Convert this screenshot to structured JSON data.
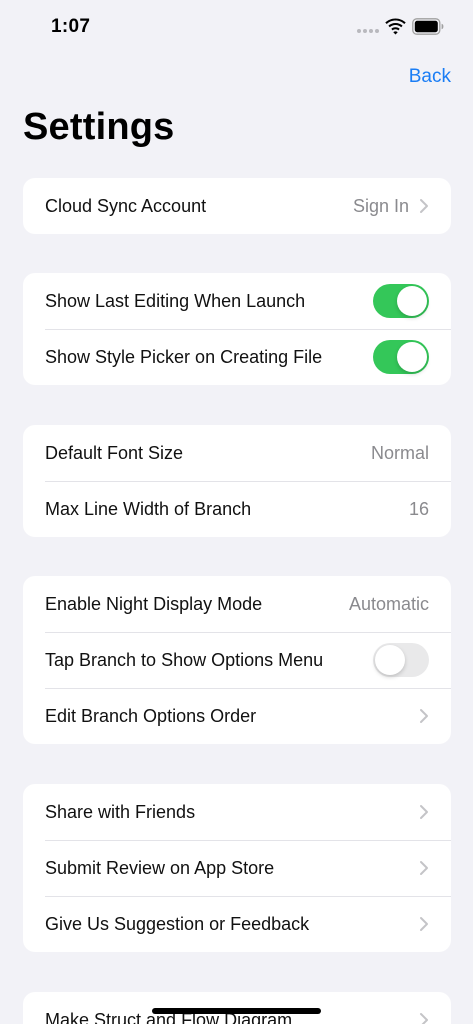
{
  "status_bar": {
    "time": "1:07",
    "icons": [
      "cellular-dots-icon",
      "wifi-icon",
      "battery-icon"
    ]
  },
  "nav": {
    "back_label": "Back",
    "title": "Settings"
  },
  "colors": {
    "accent": "#1a7df5",
    "toggle_on": "#34c759",
    "toggle_off": "#e9e9ea",
    "background": "#f2f2f7",
    "secondary_text": "#8a8a8e"
  },
  "groups": [
    {
      "rows": [
        {
          "label": "Cloud Sync Account",
          "value": "Sign In",
          "accessory": "chevron-right-icon"
        }
      ]
    },
    {
      "rows": [
        {
          "label": "Show Last Editing When Launch",
          "toggle": true
        },
        {
          "label": "Show Style Picker on Creating File",
          "toggle": true
        }
      ]
    },
    {
      "rows": [
        {
          "label": "Default Font Size",
          "value": "Normal"
        },
        {
          "label": "Max Line Width of Branch",
          "value": "16"
        }
      ]
    },
    {
      "rows": [
        {
          "label": "Enable Night Display Mode",
          "value": "Automatic"
        },
        {
          "label": "Tap Branch to Show Options Menu",
          "toggle": false
        },
        {
          "label": "Edit Branch Options Order",
          "accessory": "chevron-right-icon"
        }
      ]
    },
    {
      "rows": [
        {
          "label": "Share with Friends",
          "accessory": "chevron-right-icon"
        },
        {
          "label": "Submit Review on App Store",
          "accessory": "chevron-right-icon"
        },
        {
          "label": "Give Us Suggestion or Feedback",
          "accessory": "chevron-right-icon"
        }
      ]
    },
    {
      "rows": [
        {
          "label": "Make Struct and Flow Diagram",
          "accessory": "chevron-right-icon"
        }
      ]
    }
  ]
}
